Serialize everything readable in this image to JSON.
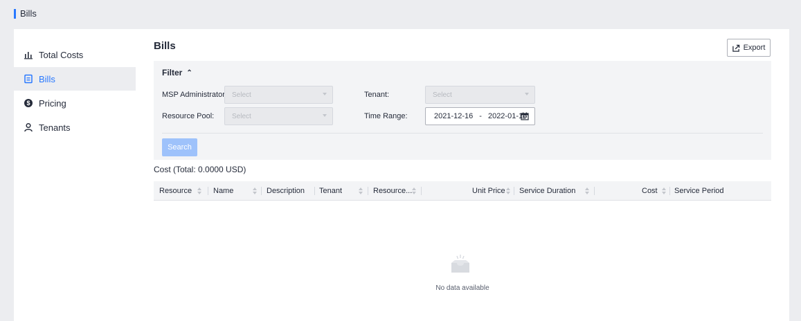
{
  "page": {
    "title": "Bills"
  },
  "sidebar": {
    "items": [
      {
        "label": "Total Costs",
        "icon": "bar-chart-icon",
        "active": false
      },
      {
        "label": "Bills",
        "icon": "bill-icon",
        "active": true
      },
      {
        "label": "Pricing",
        "icon": "dollar-circle-icon",
        "active": false
      },
      {
        "label": "Tenants",
        "icon": "user-icon",
        "active": false
      }
    ]
  },
  "main": {
    "title": "Bills",
    "export_label": "Export",
    "filter": {
      "title": "Filter",
      "msp_label": "MSP Administrator:",
      "msp_placeholder": "Select",
      "tenant_label": "Tenant:",
      "tenant_placeholder": "Select",
      "pool_label": "Resource Pool:",
      "pool_placeholder": "Select",
      "time_label": "Time Range:",
      "time_start": "2021-12-16",
      "time_sep": "-",
      "time_end": "2022-01-16",
      "search_label": "Search"
    },
    "cost_total": "Cost (Total: 0.0000 USD)",
    "columns": [
      "Resource",
      "Name",
      "Description",
      "Tenant",
      "Resource...",
      "Unit Price",
      "Service Duration",
      "Cost",
      "Service Period"
    ],
    "empty_text": "No data available"
  },
  "colors": {
    "accent": "#2878ff",
    "search_button": "#9ec2fb"
  }
}
